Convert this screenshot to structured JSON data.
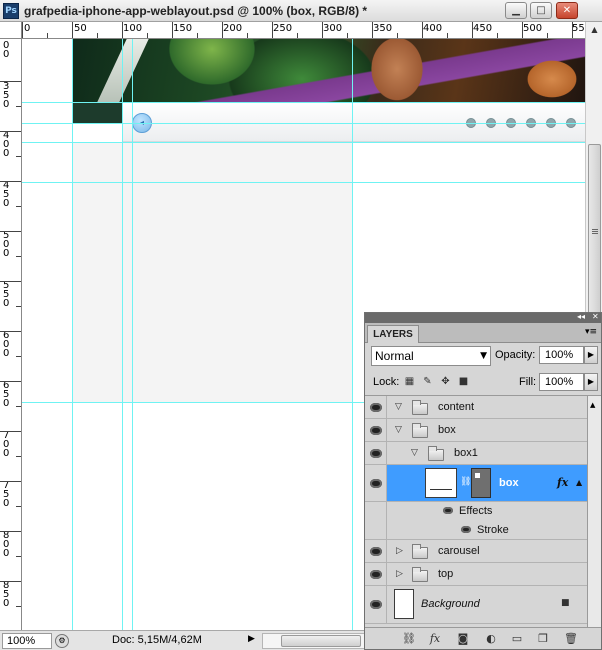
{
  "window": {
    "title": "grafpedia-iphone-app-weblayout.psd @ 100% (box, RGB/8) *",
    "app_icon": "Ps",
    "minimize_glyph": "▁",
    "maximize_glyph": "□",
    "close_glyph": "✕"
  },
  "ruler_top": {
    "labels": [
      "0",
      "50",
      "100",
      "150",
      "200",
      "250",
      "300",
      "350",
      "400",
      "450",
      "500",
      "55"
    ]
  },
  "ruler_left": {
    "labels": [
      "00",
      "350",
      "400",
      "450",
      "500",
      "550",
      "600",
      "650",
      "700",
      "750",
      "800",
      "850"
    ]
  },
  "canvas": {
    "prev_arrow_glyph": "◂",
    "carousel_dots": 6,
    "guide_color": "#6ff3f3",
    "accent_blue": "#7ab8e8"
  },
  "statusbar": {
    "zoom": "100%",
    "doc_info": "Doc: 5,15M/4,62M",
    "arrow_glyph": "▶"
  },
  "layers_panel": {
    "tab_label": "LAYERS",
    "menu_glyph": "▾≡",
    "collapse_glyph": "◂◂",
    "close_glyph": "✕",
    "blend_mode": "Normal",
    "opacity_label": "Opacity:",
    "opacity_value": "100%",
    "lock_label": "Lock:",
    "fill_label": "Fill:",
    "fill_value": "100%",
    "selected_color": "#3f9cff",
    "layers": [
      {
        "name": "content",
        "kind": "group",
        "expanded": true
      },
      {
        "name": "box",
        "kind": "group",
        "expanded": true
      },
      {
        "name": "box1",
        "kind": "group",
        "expanded": true
      },
      {
        "name": "box",
        "kind": "layer",
        "selected": true,
        "fx": "fx"
      },
      {
        "name": "Effects",
        "kind": "effects"
      },
      {
        "name": "Stroke",
        "kind": "effect"
      },
      {
        "name": "carousel",
        "kind": "group",
        "expanded": false
      },
      {
        "name": "top",
        "kind": "group",
        "expanded": false
      },
      {
        "name": "Background",
        "kind": "background"
      }
    ]
  }
}
